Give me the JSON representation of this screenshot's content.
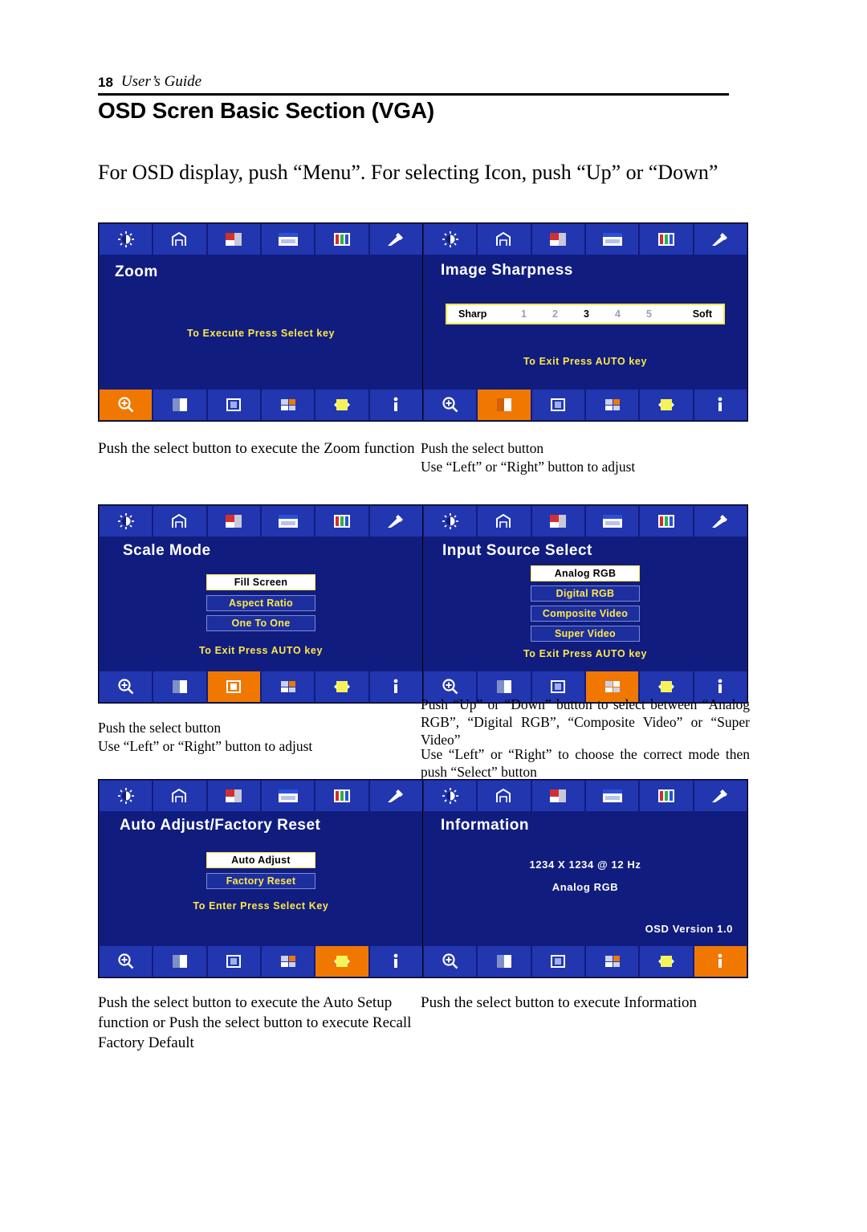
{
  "header": {
    "page_number": "18",
    "guide_label": "User’s Guide"
  },
  "chapter_title": "OSD Scren Basic Section (VGA)",
  "intro": "For OSD display, push “Menu”.  For selecting Icon, push “Up” or “Down”",
  "top_icons": [
    "brightness-contrast-icon",
    "position-icon",
    "color-page-icon",
    "osd-window-icon",
    "rgb-bars-icon",
    "tools-icon"
  ],
  "bottom_icons": [
    "zoom-icon",
    "sharpness-icon",
    "scale-mode-icon",
    "input-source-icon",
    "auto-adjust-icon",
    "information-icon"
  ],
  "panels": [
    {
      "id": "zoom",
      "title": "Zoom",
      "selected_bottom_index": 0,
      "hint": "To Execute Press Select key",
      "options": [],
      "caption": "Push the select button to execute the Zoom function"
    },
    {
      "id": "sharpness",
      "title": "Image  Sharpness",
      "selected_bottom_index": 1,
      "hint": "To Exit Press AUTO key",
      "slider": {
        "left_label": "Sharp",
        "right_label": "Soft",
        "ticks": [
          "1",
          "2",
          "3",
          "4",
          "5"
        ],
        "active_tick": "3"
      },
      "caption_line1": "Push the select button",
      "caption_line2": "Use “Left” or “Right” button to adjust"
    },
    {
      "id": "scale_mode",
      "title": "Scale  Mode",
      "selected_bottom_index": 2,
      "hint": "To Exit Press AUTO key",
      "options": [
        "Fill Screen",
        "Aspect Ratio",
        "One To One"
      ],
      "selected_option": "Fill Screen",
      "caption_line1": "Push the select button",
      "caption_line2": "Use “Left” or “Right” button to adjust"
    },
    {
      "id": "input_source",
      "title": "Input  Source  Select",
      "selected_bottom_index": 3,
      "hint": "To Exit Press AUTO key",
      "options": [
        "Analog RGB",
        "Digital RGB",
        "Composite Video",
        "Super Video"
      ],
      "selected_option": "Analog RGB",
      "caption_line1": "Push “Up” or “Down” button to select between “Analog RGB”, “Digital RGB”, “Composite Video” or “Super Video”",
      "caption_line2": "Use “Left” or “Right” to choose the correct mode then push “Select” button"
    },
    {
      "id": "auto_adjust",
      "title": "Auto  Adjust/Factory  Reset",
      "selected_bottom_index": 4,
      "hint": "To Enter Press Select Key",
      "options": [
        "Auto Adjust",
        "Factory Reset"
      ],
      "selected_option": "Auto Adjust",
      "caption": "Push the select button to execute the Auto Setup function or Push the select button to execute Recall Factory Default"
    },
    {
      "id": "information",
      "title": "Information",
      "selected_bottom_index": 5,
      "info_line1": "1234   X   1234   @   12 Hz",
      "info_line2": "Analog RGB",
      "info_version": "OSD Version 1.0",
      "caption": "Push the select button to execute Information"
    }
  ],
  "colors": {
    "osd_bg": "#101d7e",
    "osd_cell": "#2236b0",
    "osd_selected": "#f07800",
    "osd_yellow": "#ffe84a",
    "osd_white": "#ffffff"
  }
}
